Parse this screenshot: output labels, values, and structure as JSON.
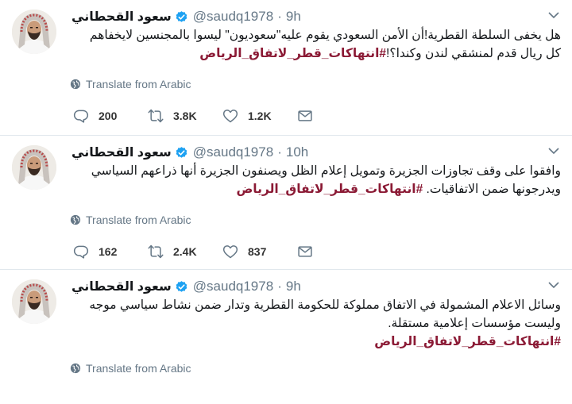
{
  "tweets": [
    {
      "author_name": "سعود القحطاني",
      "handle": "@saudq1978",
      "separator": "·",
      "time": "9h",
      "text": "هل يخفى السلطة القطرية!أن الأمن السعودي يقوم عليه\"سعوديون\" ليسوا بالمجنسين لايخفاهم كل ريال قدم لمنشقي لندن وكندا؟!",
      "hashtag": "#انتهاكات_قطر_لاتفاق_الرياض",
      "translate_label": "Translate from Arabic",
      "reply_count": "200",
      "retweet_count": "3.8K",
      "like_count": "1.2K"
    },
    {
      "author_name": "سعود القحطاني",
      "handle": "@saudq1978",
      "separator": "·",
      "time": "10h",
      "text": "وافقوا على وقف تجاوزات الجزيرة وتمويل إعلام الظل ويصنفون الجزيرة أنها ذراعهم السياسي ويدرجونها ضمن الاتفاقيات.",
      "hashtag": "#انتهاكات_قطر_لاتفاق_الرياض",
      "translate_label": "Translate from Arabic",
      "reply_count": "162",
      "retweet_count": "2.4K",
      "like_count": "837"
    },
    {
      "author_name": "سعود القحطاني",
      "handle": "@saudq1978",
      "separator": "·",
      "time": "9h",
      "text": "وسائل الاعلام المشمولة في الاتفاق مملوكة للحكومة القطرية وتدار ضمن نشاط سياسي موجه وليست مؤسسات إعلامية مستقلة.",
      "hashtag": "#انتهاكات_قطر_لاتفاق_الرياض",
      "translate_label": "Translate from Arabic",
      "reply_count": "",
      "retweet_count": "",
      "like_count": ""
    }
  ],
  "colors": {
    "hashtag": "#8b1a35",
    "verified": "#1da1f2",
    "secondary_text": "#657786",
    "divider": "#e1e8ed"
  },
  "icons": [
    "chevron-down-icon",
    "verified-badge-icon",
    "globe-icon",
    "reply-icon",
    "retweet-icon",
    "like-icon",
    "direct-message-icon"
  ]
}
